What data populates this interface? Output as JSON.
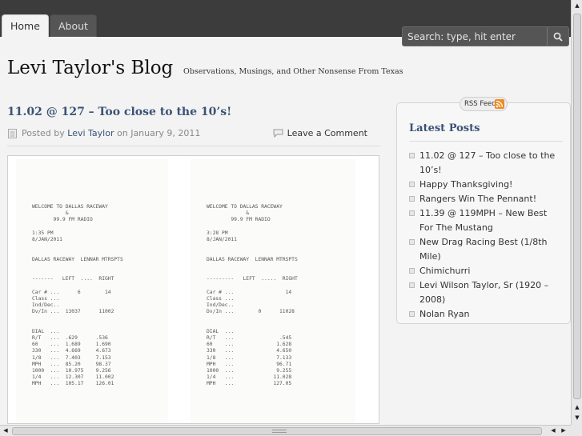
{
  "nav": {
    "home": "Home",
    "about": "About"
  },
  "search": {
    "placeholder": "Search: type, hit enter",
    "icon": "magnifier-icon"
  },
  "header": {
    "title": "Levi Taylor's Blog",
    "tagline": "Observations, Musings, and Other Nonsense From Texas"
  },
  "post": {
    "title": "11.02 @ 127 – Too close to the 10’s!",
    "posted_by": "Posted by",
    "author": "Levi Taylor",
    "on_date": "on January 9, 2011",
    "comment_link": "Leave a Comment"
  },
  "receipts": {
    "left": "WELCOME TO DALLAS RACEWAY\n           &\n       99.9 FM RADIO\n\n1:35 PM\n8/JAN/2011\n\n\nDALLAS RACEWAY  LENNAR MTRSPTS\n\n\n-------   LEFT  ....  RIGHT\n\nCar # ...      6        14\nClass ...\nInd/Dec..\nDv/In ...  13037      11002\n\n\nDIAL  ...\nR/T   ...  .629      .536\n60    ...  1.689     1.690\n330   ...  4.669     4.673\n1/8   ...  7.403     7.153\nMPH   ...  85.20     98.37\n1000  ...  10.975    9.256\n1/4   ...  12.307    11.002\nMPH   ...  105.17    126.01",
    "right": "WELCOME TO DALLAS RACEWAY\n             &\n        99.9 FM RADIO\n\n3:28 PM\n8/JAN/2011\n\n\nDALLAS RACEWAY  LENNAR MTRSPTS\n\n\n---------   LEFT  .....  RIGHT\n\nCar # ...                 14\nClass ...\nInd/Dec..\nDv/In ...        0      11028\n\n\nDIAL  ...\nR/T   ...               .545\n60    ...              1.628\n330   ...              4.650\n1/8   ...              7.133\nMPH   ...              96.71\n1000  ...              9.255\n1/4   ...             11.028\nMPH   ...             127.05"
  },
  "sidebar": {
    "rss_label": "RSS Feed",
    "heading": "Latest Posts",
    "items": [
      "11.02 @ 127 – Too close to the 10’s!",
      "Happy Thanksgiving!",
      "Rangers Win The Pennant!",
      "11.39 @ 119MPH – New Best For The Mustang",
      "New Drag Racing Best (1/8th Mile)",
      "Chimichurri",
      "Levi Wilson Taylor, Sr (1920 – 2008)",
      "Nolan Ryan"
    ]
  },
  "colors": {
    "topbar": "#3c3c3c",
    "link": "#3a5276",
    "background": "#f3f3f3"
  }
}
